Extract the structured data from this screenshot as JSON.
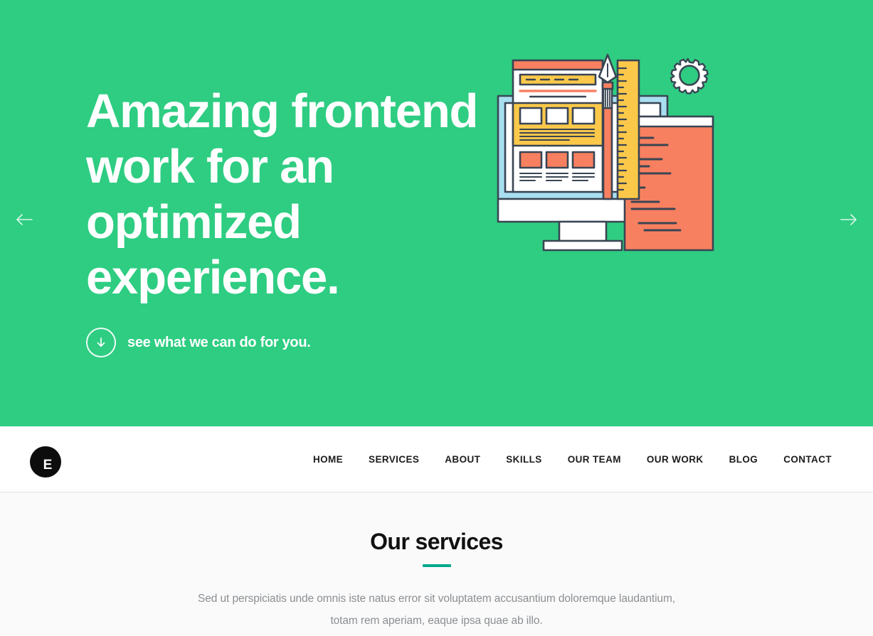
{
  "hero": {
    "title": "Amazing frontend work for an optimized experience.",
    "subtitle": "see what we can do for you.",
    "scroll_icon": "arrow-down-circle-icon",
    "prev_icon": "arrow-left-icon",
    "next_icon": "arrow-right-icon",
    "background_color": "#2ecd82",
    "text_color": "#ffffff",
    "illustration": {
      "name": "frontend-design-illustration",
      "elements": [
        "monitor-wireframe",
        "fountain-pen",
        "ruler",
        "gear",
        "code-document"
      ],
      "colors": {
        "outline": "#3a4553",
        "white": "#ffffff",
        "coral": "#f78060",
        "yellow": "#fbc84a",
        "light_blue": "#a8dff0"
      }
    }
  },
  "navbar": {
    "logo_letter": "E",
    "logo_color": "#0d0d0d",
    "items": [
      {
        "label": "HOME"
      },
      {
        "label": "SERVICES"
      },
      {
        "label": "ABOUT"
      },
      {
        "label": "SKILLS"
      },
      {
        "label": "OUR TEAM"
      },
      {
        "label": "OUR WORK"
      },
      {
        "label": "BLOG"
      },
      {
        "label": "CONTACT"
      }
    ]
  },
  "services": {
    "title": "Our services",
    "accent_color": "#00a88e",
    "lead": "Sed ut perspiciatis unde omnis iste natus error sit voluptatem accusantium doloremque laudantium, totam rem aperiam, eaque ipsa quae ab illo.",
    "background_color": "#fafafa"
  }
}
